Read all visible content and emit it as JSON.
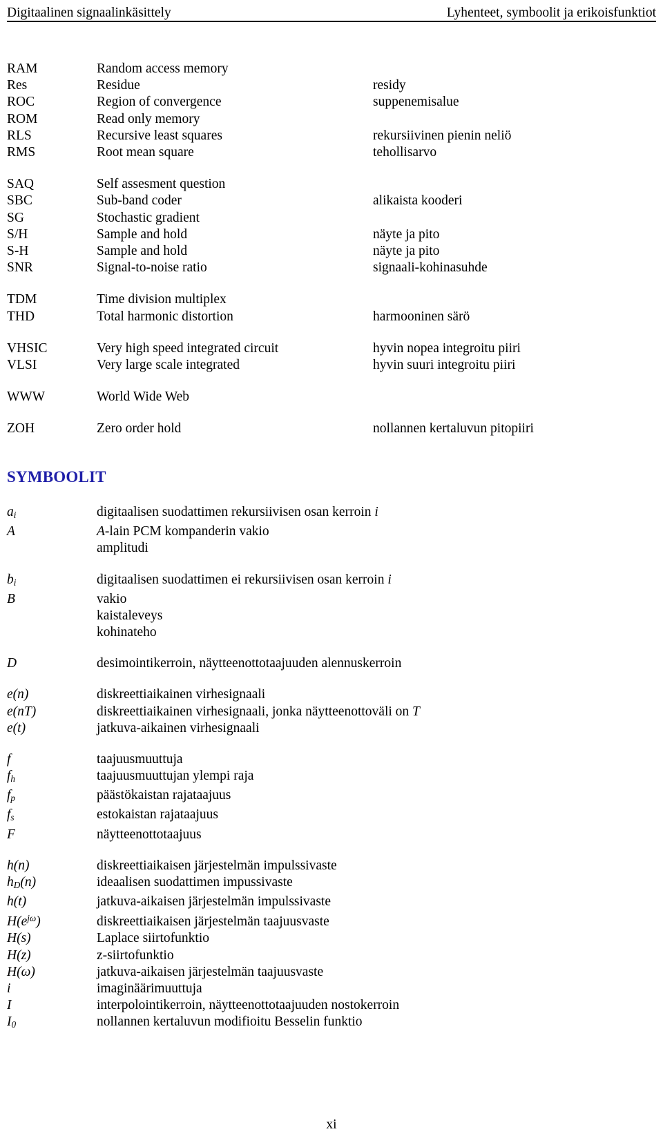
{
  "header": {
    "left": "Digitaalinen signaalinkäsittely",
    "right": "Lyhenteet, symboolit ja erikoisfunktiot"
  },
  "abbreviations": {
    "groups": [
      {
        "rows": [
          {
            "abbr": "RAM",
            "english": "Random access memory",
            "finnish": ""
          },
          {
            "abbr": "Res",
            "english": "Residue",
            "finnish": "residy"
          },
          {
            "abbr": "ROC",
            "english": "Region of convergence",
            "finnish": "suppenemisalue"
          },
          {
            "abbr": "ROM",
            "english": "Read only memory",
            "finnish": ""
          },
          {
            "abbr": "RLS",
            "english": "Recursive least squares",
            "finnish": "rekursiivinen pienin neliö"
          },
          {
            "abbr": "RMS",
            "english": "Root mean square",
            "finnish": "tehollisarvo"
          }
        ]
      },
      {
        "rows": [
          {
            "abbr": "SAQ",
            "english": "Self assesment question",
            "finnish": ""
          },
          {
            "abbr": "SBC",
            "english": "Sub-band coder",
            "finnish": "alikaista kooderi"
          },
          {
            "abbr": "SG",
            "english": "Stochastic gradient",
            "finnish": ""
          },
          {
            "abbr": "S/H",
            "english": "Sample and hold",
            "finnish": "näyte ja pito"
          },
          {
            "abbr": "S-H",
            "english": "Sample and hold",
            "finnish": "näyte ja pito"
          },
          {
            "abbr": "SNR",
            "english": "Signal-to-noise ratio",
            "finnish": "signaali-kohinasuhde"
          }
        ]
      },
      {
        "rows": [
          {
            "abbr": "TDM",
            "english": "Time division multiplex",
            "finnish": ""
          },
          {
            "abbr": "THD",
            "english": "Total harmonic distortion",
            "finnish": "harmooninen särö"
          }
        ]
      },
      {
        "rows": [
          {
            "abbr": "VHSIC",
            "english": "Very high speed integrated circuit",
            "finnish": "hyvin nopea integroitu piiri"
          },
          {
            "abbr": "VLSI",
            "english": "Very large scale integrated",
            "finnish": "hyvin suuri integroitu piiri"
          }
        ]
      },
      {
        "rows": [
          {
            "abbr": "WWW",
            "english": "World Wide Web",
            "finnish": ""
          }
        ]
      },
      {
        "rows": [
          {
            "abbr": "ZOH",
            "english": "Zero order hold",
            "finnish": "nollannen kertaluvun pitopiiri"
          }
        ]
      }
    ]
  },
  "symbols_heading": "SYMBOOLIT",
  "symbols": {
    "groups": [
      {
        "rows": [
          {
            "symbol_html": "a<sub>i</sub>",
            "symbol_text": "a_i",
            "desc_html": "digitaalisen suodattimen rekursiivisen osan kerroin <i>i</i>",
            "desc_text": "digitaalisen suodattimen rekursiivisen osan kerroin i"
          },
          {
            "symbol_html": "A",
            "symbol_text": "A",
            "desc_html": "<i>A</i>-lain PCM kompanderin vakio",
            "desc_text": "A-lain PCM kompanderin vakio"
          },
          {
            "symbol_html": "",
            "symbol_text": "",
            "desc_html": "amplitudi",
            "desc_text": "amplitudi"
          }
        ]
      },
      {
        "rows": [
          {
            "symbol_html": "b<sub>i</sub>",
            "symbol_text": "b_i",
            "desc_html": "digitaalisen suodattimen ei rekursiivisen osan kerroin <i>i</i>",
            "desc_text": "digitaalisen suodattimen ei rekursiivisen osan kerroin i"
          },
          {
            "symbol_html": "B",
            "symbol_text": "B",
            "desc_html": "vakio",
            "desc_text": "vakio"
          },
          {
            "symbol_html": "",
            "symbol_text": "",
            "desc_html": "kaistaleveys",
            "desc_text": "kaistaleveys"
          },
          {
            "symbol_html": "",
            "symbol_text": "",
            "desc_html": "kohinateho",
            "desc_text": "kohinateho"
          }
        ]
      },
      {
        "rows": [
          {
            "symbol_html": "D",
            "symbol_text": "D",
            "desc_html": "desimointikerroin, näytteenottotaajuuden alennuskerroin",
            "desc_text": "desimointikerroin, näytteenottotaajuuden alennuskerroin"
          }
        ]
      },
      {
        "rows": [
          {
            "symbol_html": "e(<i>n</i>)",
            "symbol_text": "e(n)",
            "desc_html": "diskreettiaikainen virhesignaali",
            "desc_text": "diskreettiaikainen virhesignaali"
          },
          {
            "symbol_html": "e(<i>nT</i>)",
            "symbol_text": "e(nT)",
            "desc_html": "diskreettiaikainen virhesignaali, jonka näytteenottoväli on <i>T</i>",
            "desc_text": "diskreettiaikainen virhesignaali, jonka näytteenottoväli on T"
          },
          {
            "symbol_html": "e(<i>t</i>)",
            "symbol_text": "e(t)",
            "desc_html": "jatkuva-aikainen virhesignaali",
            "desc_text": "jatkuva-aikainen virhesignaali"
          }
        ]
      },
      {
        "rows": [
          {
            "symbol_html": "f",
            "symbol_text": "f",
            "desc_html": "taajuusmuuttuja",
            "desc_text": "taajuusmuuttuja"
          },
          {
            "symbol_html": "f<sub>h</sub>",
            "symbol_text": "f_h",
            "desc_html": "taajuusmuuttujan ylempi raja",
            "desc_text": "taajuusmuuttujan ylempi raja"
          },
          {
            "symbol_html": "f<sub>p</sub>",
            "symbol_text": "f_p",
            "desc_html": "päästökaistan rajataajuus",
            "desc_text": "päästökaistan rajataajuus"
          },
          {
            "symbol_html": "f<sub>s</sub>",
            "symbol_text": "f_s",
            "desc_html": "estokaistan rajataajuus",
            "desc_text": "estokaistan rajataajuus"
          },
          {
            "symbol_html": "F",
            "symbol_text": "F",
            "desc_html": "näytteenottotaajuus",
            "desc_text": "näytteenottotaajuus"
          }
        ]
      },
      {
        "rows": [
          {
            "symbol_html": "h(<i>n</i>)",
            "symbol_text": "h(n)",
            "desc_html": "diskreettiaikaisen järjestelmän impulssivaste",
            "desc_text": "diskreettiaikaisen järjestelmän impulssivaste"
          },
          {
            "symbol_html": "h<sub>D</sub>(<i>n</i>)",
            "symbol_text": "h_D(n)",
            "desc_html": "ideaalisen suodattimen impussivaste",
            "desc_text": "ideaalisen suodattimen impussivaste"
          },
          {
            "symbol_html": "h(<i>t</i>)",
            "symbol_text": "h(t)",
            "desc_html": "jatkuva-aikaisen järjestelmän impulssivaste",
            "desc_text": "jatkuva-aikaisen järjestelmän impulssivaste"
          },
          {
            "symbol_html": "H(e<sup>jω</sup>)",
            "symbol_text": "H(e^jω)",
            "desc_html": "diskreettiaikaisen järjestelmän taajuusvaste",
            "desc_text": "diskreettiaikaisen järjestelmän taajuusvaste"
          },
          {
            "symbol_html": "H(<i>s</i>)",
            "symbol_text": "H(s)",
            "desc_html": "Laplace siirtofunktio",
            "desc_text": "Laplace siirtofunktio"
          },
          {
            "symbol_html": "H(<i>z</i>)",
            "symbol_text": "H(z)",
            "desc_html": "z-siirtofunktio",
            "desc_text": "z-siirtofunktio"
          },
          {
            "symbol_html": "H(<i>ω</i>)",
            "symbol_text": "H(ω)",
            "desc_html": "jatkuva-aikaisen järjestelmän taajuusvaste",
            "desc_text": "jatkuva-aikaisen järjestelmän taajuusvaste"
          },
          {
            "symbol_html": "i",
            "symbol_text": "i",
            "desc_html": "imaginäärimuuttuja",
            "desc_text": "imaginäärimuuttuja"
          },
          {
            "symbol_html": "I",
            "symbol_text": "I",
            "desc_html": "interpolointikerroin, näytteenottotaajuuden nostokerroin",
            "desc_text": "interpolointikerroin, näytteenottotaajuuden nostokerroin"
          },
          {
            "symbol_html": "I<sub>0</sub>",
            "symbol_text": "I_0",
            "desc_html": "nollannen kertaluvun modifioitu Besselin funktio",
            "desc_text": "nollannen kertaluvun modifioitu Besselin funktio"
          }
        ]
      }
    ]
  },
  "footer": {
    "page_number": "xi"
  }
}
